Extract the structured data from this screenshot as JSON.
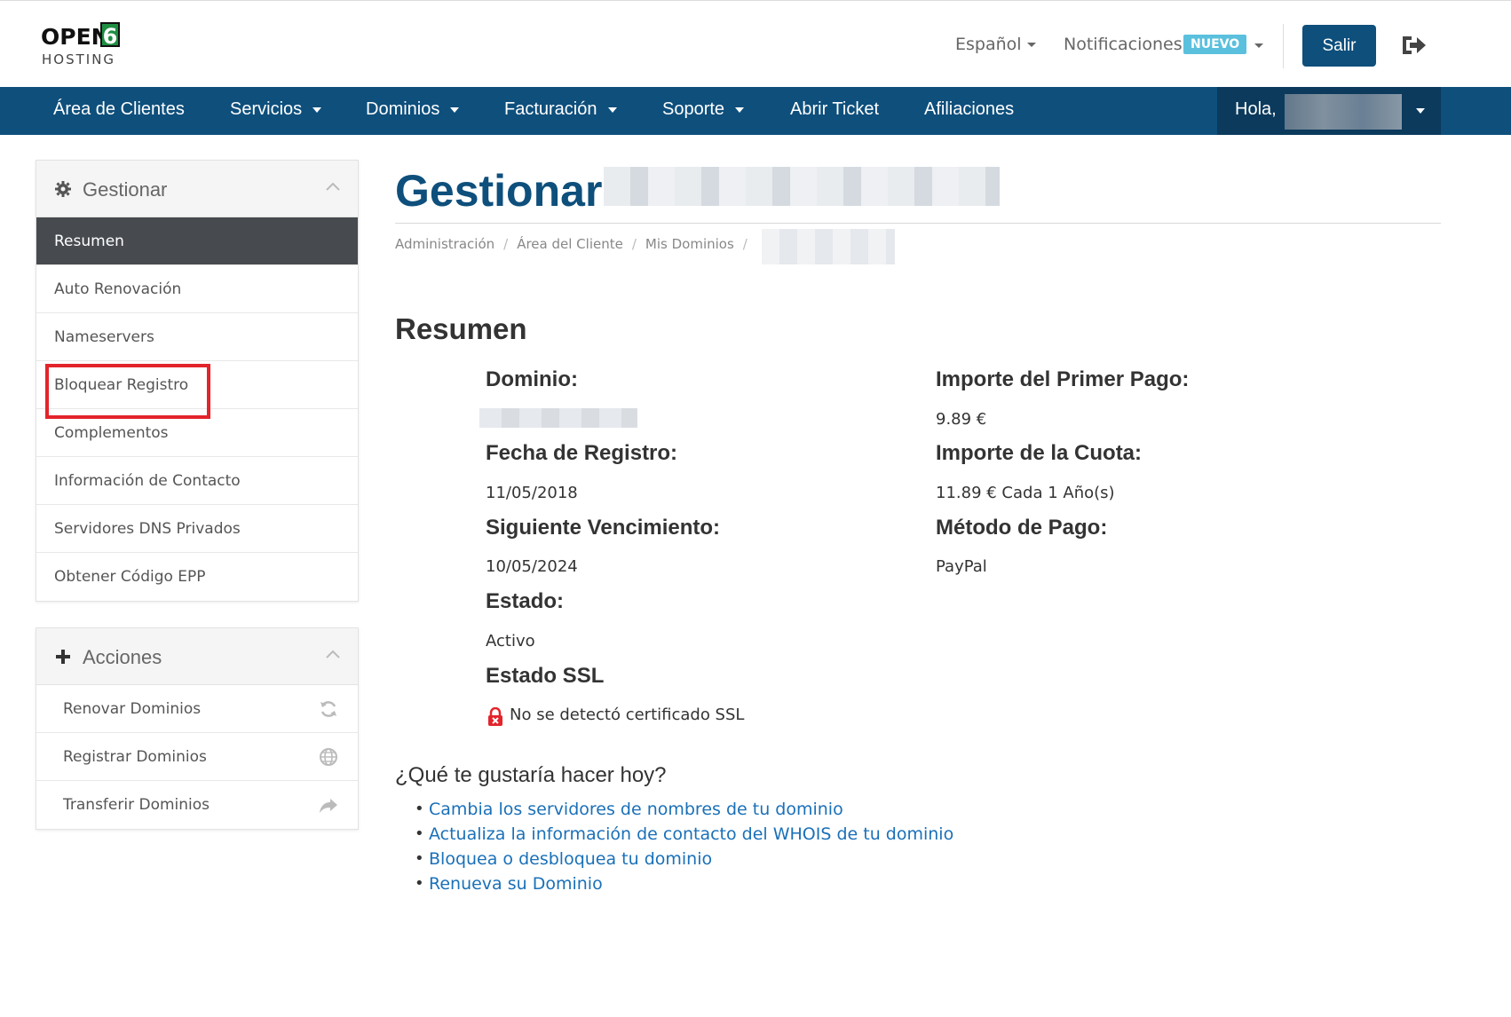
{
  "header": {
    "logo_open": "OPEN",
    "logo_six": "6",
    "logo_hosting": "HOSTING",
    "language": "Español",
    "notifications": "Notificaciones",
    "badge": "NUEVO",
    "logout_label": "Salir"
  },
  "nav": {
    "items": [
      {
        "label": "Área de Clientes"
      },
      {
        "label": "Servicios"
      },
      {
        "label": "Dominios"
      },
      {
        "label": "Facturación"
      },
      {
        "label": "Soporte"
      },
      {
        "label": "Abrir Ticket"
      },
      {
        "label": "Afiliaciones"
      }
    ],
    "greeting": "Hola,"
  },
  "sidebar": {
    "manage": {
      "title": "Gestionar",
      "items": [
        {
          "label": "Resumen"
        },
        {
          "label": "Auto Renovación"
        },
        {
          "label": "Nameservers"
        },
        {
          "label": "Bloquear Registro"
        },
        {
          "label": "Complementos"
        },
        {
          "label": "Información de Contacto"
        },
        {
          "label": "Servidores DNS Privados"
        },
        {
          "label": "Obtener Código EPP"
        }
      ]
    },
    "actions": {
      "title": "Acciones",
      "items": [
        {
          "label": "Renovar Dominios",
          "icon": "refresh-icon"
        },
        {
          "label": "Registrar Dominios",
          "icon": "globe-icon"
        },
        {
          "label": "Transferir Dominios",
          "icon": "share-icon"
        }
      ]
    }
  },
  "main": {
    "title": "Gestionar",
    "breadcrumb": [
      "Administración",
      "Área del Cliente",
      "Mis Dominios"
    ],
    "section": "Resumen",
    "left": {
      "domain_label": "Dominio:",
      "reg_date_label": "Fecha de Registro:",
      "reg_date": "11/05/2018",
      "next_due_label": "Siguiente Vencimiento:",
      "next_due": "10/05/2024",
      "status_label": "Estado:",
      "status": "Activo",
      "ssl_label": "Estado SSL",
      "ssl_value": "No se detectó certificado SSL"
    },
    "right": {
      "first_payment_label": "Importe del Primer Pago:",
      "first_payment": "9.89 €",
      "recurring_label": "Importe de la Cuota:",
      "recurring": "11.89 € Cada 1 Año(s)",
      "payment_method_label": "Método de Pago:",
      "payment_method": "PayPal"
    },
    "question": "¿Qué te gustaría hacer hoy?",
    "links": [
      "Cambia los servidores de nombres de tu dominio",
      "Actualiza la información de contacto del WHOIS de tu dominio",
      "Bloquea o desbloquea tu dominio",
      "Renueva su Dominio"
    ]
  },
  "colors": {
    "brand": "#0e4f7c",
    "link": "#1a70b8",
    "badge": "#5bc0de",
    "highlight": "#e3242b"
  }
}
